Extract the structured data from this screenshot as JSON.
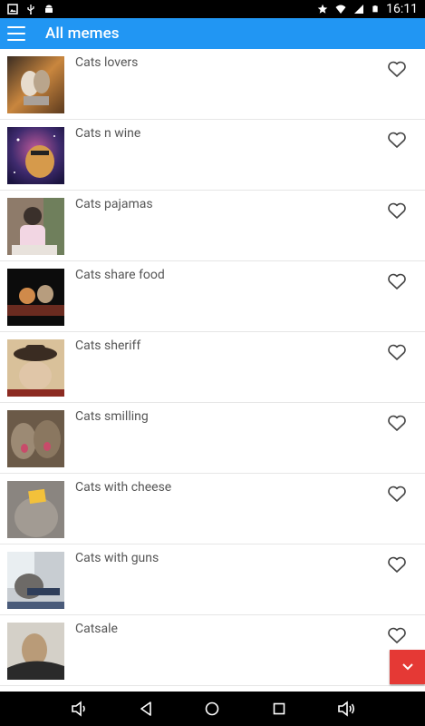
{
  "status": {
    "time": "16:11",
    "icons": [
      "photo-icon",
      "usb-icon",
      "android-icon",
      "star-icon",
      "wifi-icon",
      "signal-icon",
      "battery-icon"
    ]
  },
  "appbar": {
    "title": "All memes",
    "menu_icon": "hamburger-icon",
    "color": "#2196f3"
  },
  "items": [
    {
      "label": "Cats lovers"
    },
    {
      "label": "Cats n wine"
    },
    {
      "label": "Cats pajamas"
    },
    {
      "label": "Cats share food"
    },
    {
      "label": "Cats sheriff"
    },
    {
      "label": "Cats smilling"
    },
    {
      "label": "Cats with cheese"
    },
    {
      "label": "Cats with guns"
    },
    {
      "label": "Catsale"
    }
  ],
  "fab": {
    "icon": "chevron-down-icon",
    "color": "#e53935"
  },
  "navbar": {
    "icons": [
      "volume-down-icon",
      "back-icon",
      "home-icon",
      "recents-icon",
      "volume-up-icon"
    ]
  }
}
